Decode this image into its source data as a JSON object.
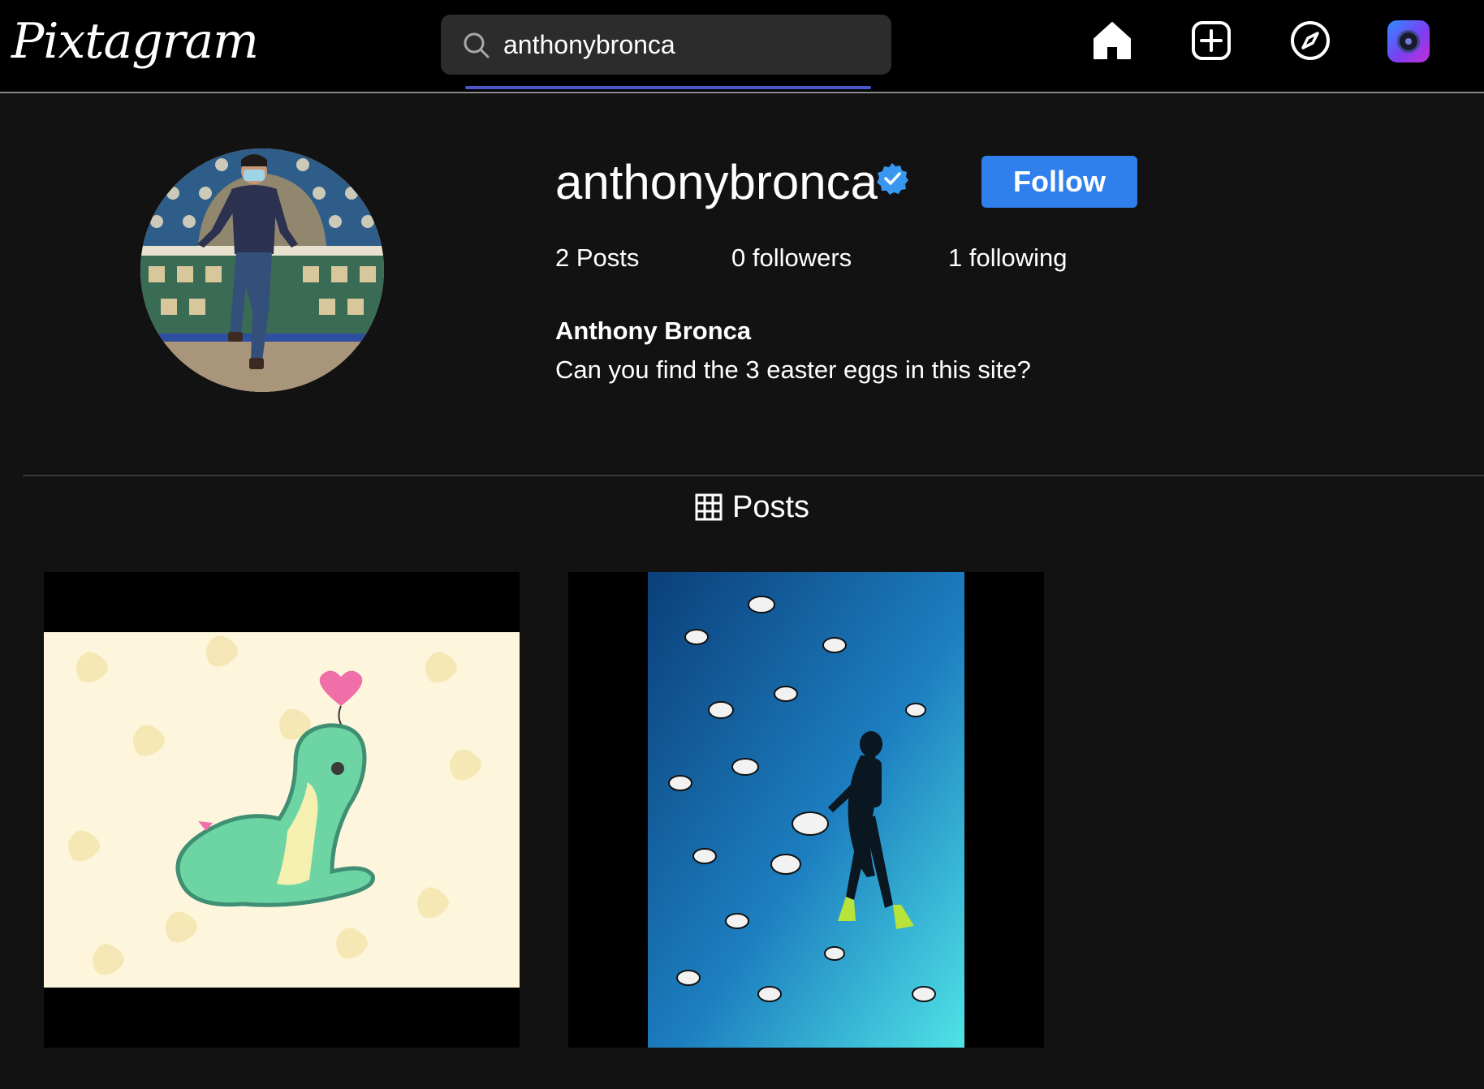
{
  "app": {
    "logo_text": "Pixtagram"
  },
  "search": {
    "value": "anthonybronca",
    "placeholder": "Search"
  },
  "nav": {
    "icons": [
      "home-icon",
      "new-post-icon",
      "explore-icon",
      "profile-avatar"
    ]
  },
  "profile": {
    "username": "anthonybronca",
    "verified": true,
    "follow_label": "Follow",
    "posts_count": "2 Posts",
    "followers_count": "0 followers",
    "following_count": "1 following",
    "full_name": "Anthony Bronca",
    "bio": "Can you find the 3 easter eggs in this site?"
  },
  "tabs": {
    "posts_label": "Posts"
  },
  "posts": [
    {
      "subject": "cartoon green dinosaur with heart balloon"
    },
    {
      "subject": "scuba diver among striped fish underwater"
    }
  ],
  "colors": {
    "topbar_bg": "#000000",
    "page_bg": "#121212",
    "accent": "#2f80ed",
    "search_underline": "#4b56c9",
    "verified": "#3897f0"
  }
}
